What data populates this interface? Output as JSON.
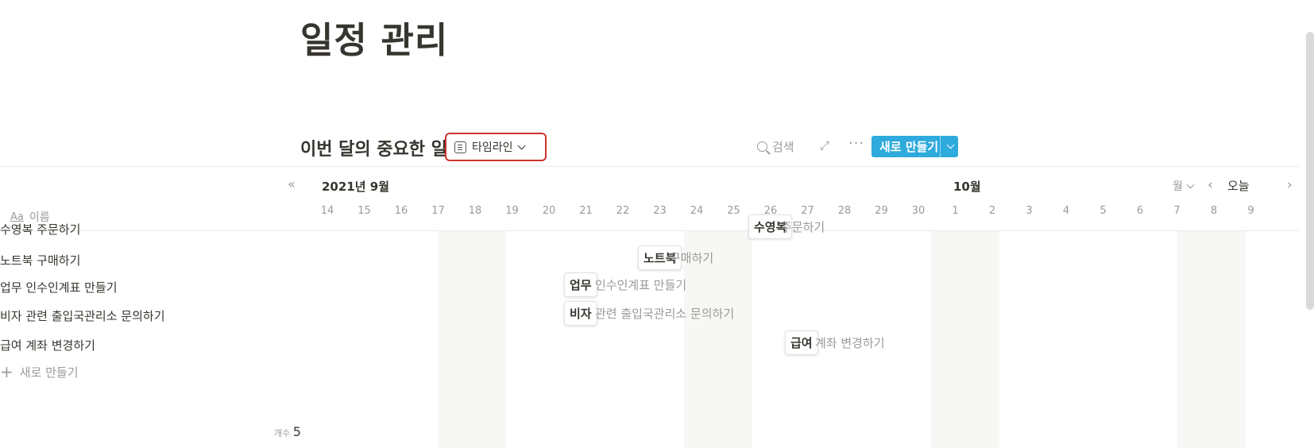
{
  "page": {
    "title": "일정 관리"
  },
  "database": {
    "title": "이번 달의 중요한 일",
    "view": {
      "label": "타임라인",
      "icon": "timeline-view-icon"
    },
    "toolbar": {
      "search_label": "검색",
      "new_label": "새로 만들기",
      "expand_icon": "expand-icon",
      "more_icon": "more-icon"
    }
  },
  "table": {
    "name_header": "이름",
    "rows": [
      {
        "name": "수영복 주문하기"
      },
      {
        "name": "노트북 구매하기"
      },
      {
        "name": "업무 인수인계표 만들기"
      },
      {
        "name": "비자 관련 출입국관리소 문의하기"
      },
      {
        "name": "급여 계좌 변경하기"
      }
    ],
    "add_label": "새로 만들기",
    "count_label": "개수",
    "count_value": "5"
  },
  "timeline": {
    "month_label": "2021년 9월",
    "next_month_label": "10월",
    "zoom_label": "월",
    "today_label": "오늘",
    "days": [
      "14",
      "15",
      "16",
      "17",
      "18",
      "19",
      "20",
      "21",
      "22",
      "23",
      "24",
      "25",
      "26",
      "27",
      "28",
      "29",
      "30",
      "1",
      "2",
      "3",
      "4",
      "5",
      "6",
      "7",
      "8",
      "9"
    ],
    "items": [
      {
        "chip": "수영복",
        "rest": " 주문하기"
      },
      {
        "chip": "노트북",
        "rest": " 구매하기"
      },
      {
        "chip": "업무",
        "rest": " 인수인계표 만들기"
      },
      {
        "chip": "비자",
        "rest": " 관련 출입국관리소 문의하기"
      },
      {
        "chip": "급여",
        "rest": " 계좌 변경하기"
      }
    ]
  },
  "colors": {
    "accent": "#2eaadc",
    "highlight_border": "#d0342c",
    "weekend_bg": "#f7f7f5"
  }
}
